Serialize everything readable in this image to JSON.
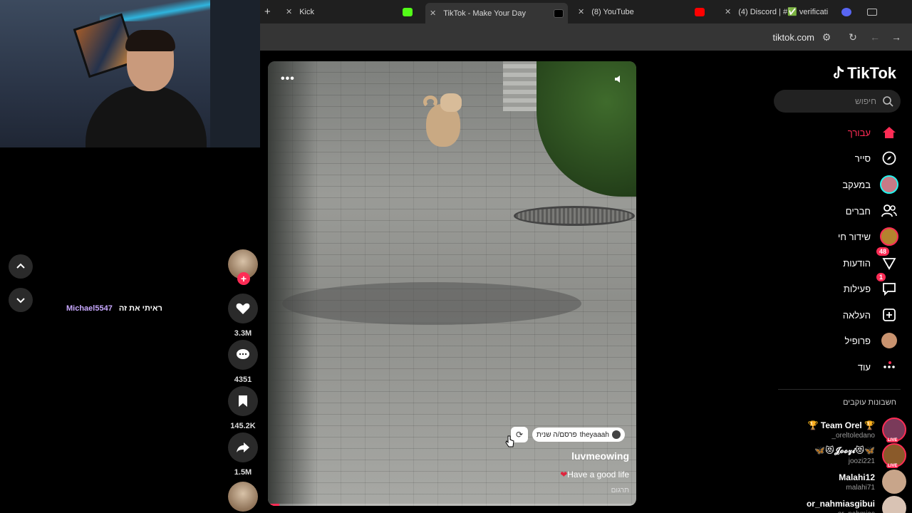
{
  "browser": {
    "new_tab_glyph": "+",
    "tabs": [
      {
        "title": "Kick",
        "favicon_color": "#53fc18",
        "active": false
      },
      {
        "title": "TikTok - Make Your Day",
        "favicon_color": "#111111",
        "active": true
      },
      {
        "title": "(8) YouTube",
        "favicon_color": "#ff0000",
        "active": false
      },
      {
        "title": "(4) Discord | #✅ verificati",
        "favicon_color": "#5865f2",
        "active": false
      }
    ],
    "address": "tiktok.com"
  },
  "stream": {
    "chat_user": "Michael5547",
    "chat_message": "ראיתי את זה"
  },
  "video": {
    "author": "luvmeowing",
    "caption": "Have a good life",
    "translate": "תרגום",
    "repost_user": "theyaaah",
    "repost_text": "פרסם/ה שנית",
    "progress": 0.03
  },
  "actions": {
    "likes": "3.3M",
    "comments": "4351",
    "saves": "145.2K",
    "shares": "1.5M"
  },
  "sidebar": {
    "logo": "TikTok",
    "search_placeholder": "חיפוש",
    "menu": [
      {
        "label": "עבורך",
        "icon": "home-icon",
        "active": true
      },
      {
        "label": "סייר",
        "icon": "compass-icon"
      },
      {
        "label": "במעקב",
        "icon": "following-avatar-icon"
      },
      {
        "label": "חברים",
        "icon": "friends-icon"
      },
      {
        "label": "שידור חי",
        "icon": "live-icon"
      },
      {
        "label": "הודעות",
        "icon": "inbox-icon",
        "badge": "48"
      },
      {
        "label": "פעילות",
        "icon": "activity-icon",
        "badge": "1"
      },
      {
        "label": "העלאה",
        "icon": "upload-icon"
      },
      {
        "label": "פרופיל",
        "icon": "profile-avatar-icon"
      },
      {
        "label": "עוד",
        "icon": "more-icon"
      }
    ],
    "following_title": "חשבונות עוקבים",
    "following": [
      {
        "name": "🏆 Team Orel 🏆",
        "handle": "_oreltoledano",
        "live": true,
        "color": "#7a3a5a"
      },
      {
        "name": "🦋😻𝓙𝓸𝓸𝔃𝓲😻🦋",
        "handle": "joozi221",
        "live": true,
        "color": "#8a5a2a"
      },
      {
        "name": "Malahi12",
        "handle": "malahi71",
        "live": false,
        "color": "#c8a58a"
      },
      {
        "name": "or_nahmiasgibui",
        "handle": "or_nahmias",
        "live": false,
        "color": "#d9c3b4"
      }
    ],
    "live_label": "LIVE"
  },
  "colors": {
    "accent": "#fe2c55"
  }
}
